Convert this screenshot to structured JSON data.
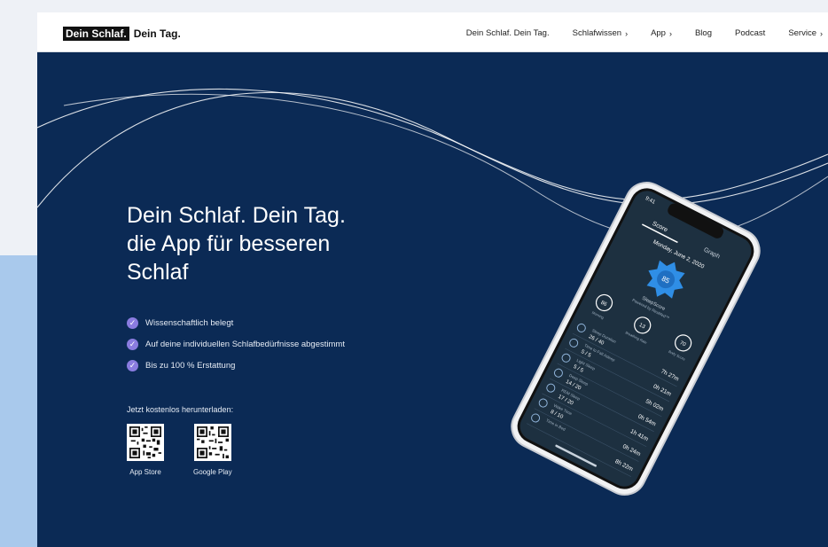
{
  "header": {
    "logo_mark": "Dein Schlaf.",
    "logo_rest": "Dein Tag.",
    "nav": [
      {
        "label": "Dein Schlaf. Dein Tag.",
        "chevron": false
      },
      {
        "label": "Schlafwissen",
        "chevron": true
      },
      {
        "label": "App",
        "chevron": true
      },
      {
        "label": "Blog",
        "chevron": false
      },
      {
        "label": "Podcast",
        "chevron": false
      },
      {
        "label": "Service",
        "chevron": true
      }
    ]
  },
  "hero": {
    "title_line1": "Dein Schlaf. Dein Tag.",
    "title_line2": "die App für besseren",
    "title_line3": "Schlaf",
    "features": [
      "Wissenschaftlich belegt",
      "Auf deine individuellen Schlafbedürfnisse abgestimmt",
      "Bis zu 100 % Erstattung"
    ],
    "download_label": "Jetzt kostenlos herunterladen:",
    "stores": [
      {
        "label": "App Store",
        "icon": "qr-code-icon"
      },
      {
        "label": "Google Play",
        "icon": "qr-code-icon"
      }
    ]
  },
  "phone_app": {
    "status_time": "9:41",
    "tabs": [
      "Score",
      "Graph"
    ],
    "date": "Monday, June 2, 2020",
    "sleep_score": "85",
    "score_label": "SleepScore",
    "powered_by": "Powered by ResMed™",
    "sub_scores": [
      {
        "value": "86",
        "label": "Morning"
      },
      {
        "value": "13",
        "label": "Breathing Rate"
      },
      {
        "value": "70",
        "label": "Body Score"
      }
    ],
    "rows": [
      {
        "label": "Sleep Duration",
        "score": "26 / 40",
        "value": "7h 27m"
      },
      {
        "label": "Time to Fall Asleep",
        "score": "5 / 5",
        "value": "0h 21m"
      },
      {
        "label": "Light Sleep",
        "score": "5 / 5",
        "value": "5h 02m"
      },
      {
        "label": "Deep Sleep",
        "score": "14 / 20",
        "value": "0h 54m"
      },
      {
        "label": "REM Sleep",
        "score": "17 / 20",
        "value": "1h 41m"
      },
      {
        "label": "Wake Time",
        "score": "8 / 10",
        "value": "0h 24m"
      },
      {
        "label": "Time in Bed",
        "score": "",
        "value": "8h 22m"
      }
    ]
  },
  "colors": {
    "hero_bg": "#0b2a55",
    "accent_check": "#8a7ce0",
    "score_blue": "#2f8ee6",
    "page_bg": "#eef1f6",
    "side_block": "#a9c9ec"
  }
}
